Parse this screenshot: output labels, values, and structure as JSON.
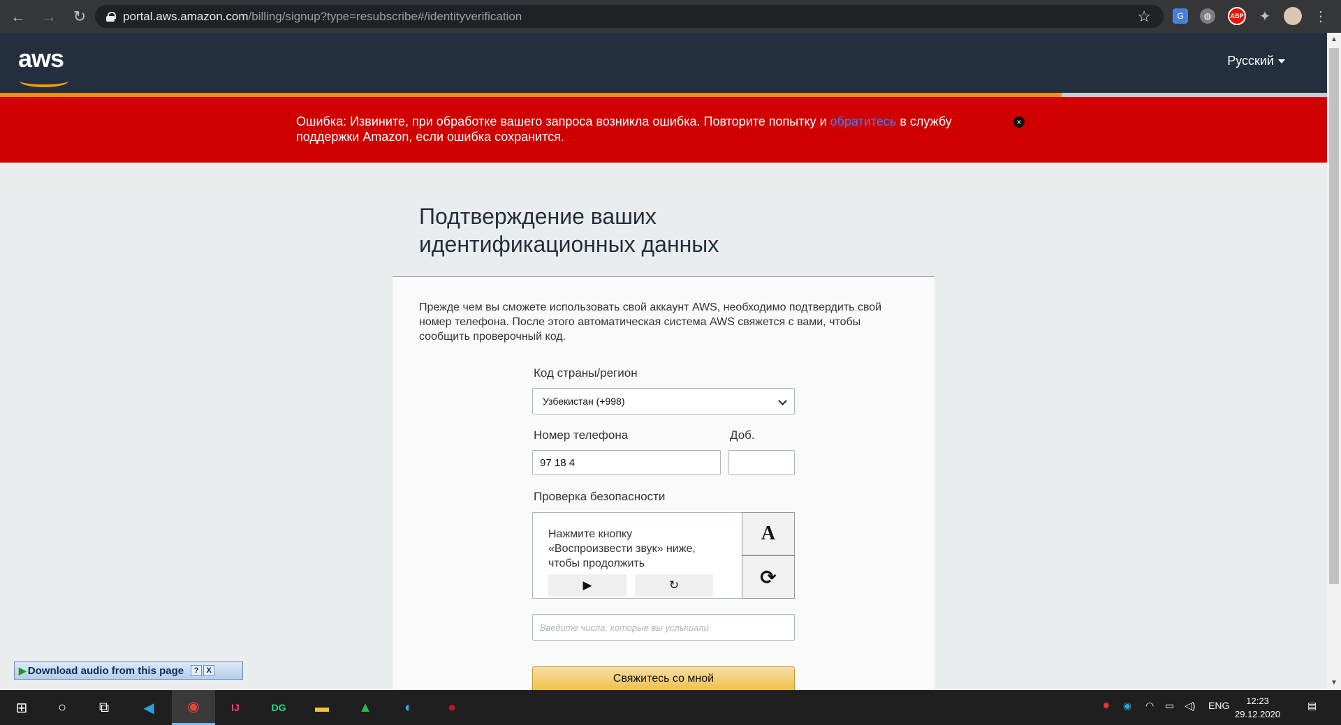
{
  "browser": {
    "url_host": "portal.aws.amazon.com",
    "url_path": "/billing/signup?type=resubscribe#/identityverification",
    "extensions": [
      "translate-icon",
      "globe-icon",
      "adblock-icon",
      "puzzle-icon",
      "profile-avatar"
    ],
    "adblock_label": "ABP"
  },
  "header": {
    "logo": "aws",
    "language": "Русский"
  },
  "error": {
    "text_before": "Ошибка: Извините, при обработке вашего запроса возникла ошибка. Повторите попытку и ",
    "link": "обратитесь",
    "text_after": " в службу поддержки Amazon, если ошибка сохранится.",
    "close": "×"
  },
  "page": {
    "title": "Подтверждение ваших идентификационных данных",
    "intro": "Прежде чем вы сможете использовать свой аккаунт AWS, необходимо подтвердить свой номер телефона. После этого автоматическая система AWS свяжется с вами, чтобы сообщить проверочный код.",
    "country_label": "Код страны/регион",
    "country_value": "Узбекистан (+998)",
    "phone_label": "Номер телефона",
    "phone_value": "97  18  4",
    "ext_label": "Доб.",
    "security_label": "Проверка безопасности",
    "captcha_text": "Нажмите кнопку «Воспроизвести звук» ниже, чтобы продолжить",
    "captcha_play": "▶",
    "captcha_replay": "↻",
    "captcha_text_mode": "A",
    "captcha_refresh": "⟳",
    "captcha_placeholder": "Введите числа, которые вы услышали",
    "contact_button": "Свяжитесь со мной"
  },
  "widget": {
    "label": "Download audio from this page",
    "help": "?",
    "close": "X"
  },
  "taskbar": {
    "language": "ENG",
    "time": "12:23",
    "date": "29.12.2020"
  }
}
